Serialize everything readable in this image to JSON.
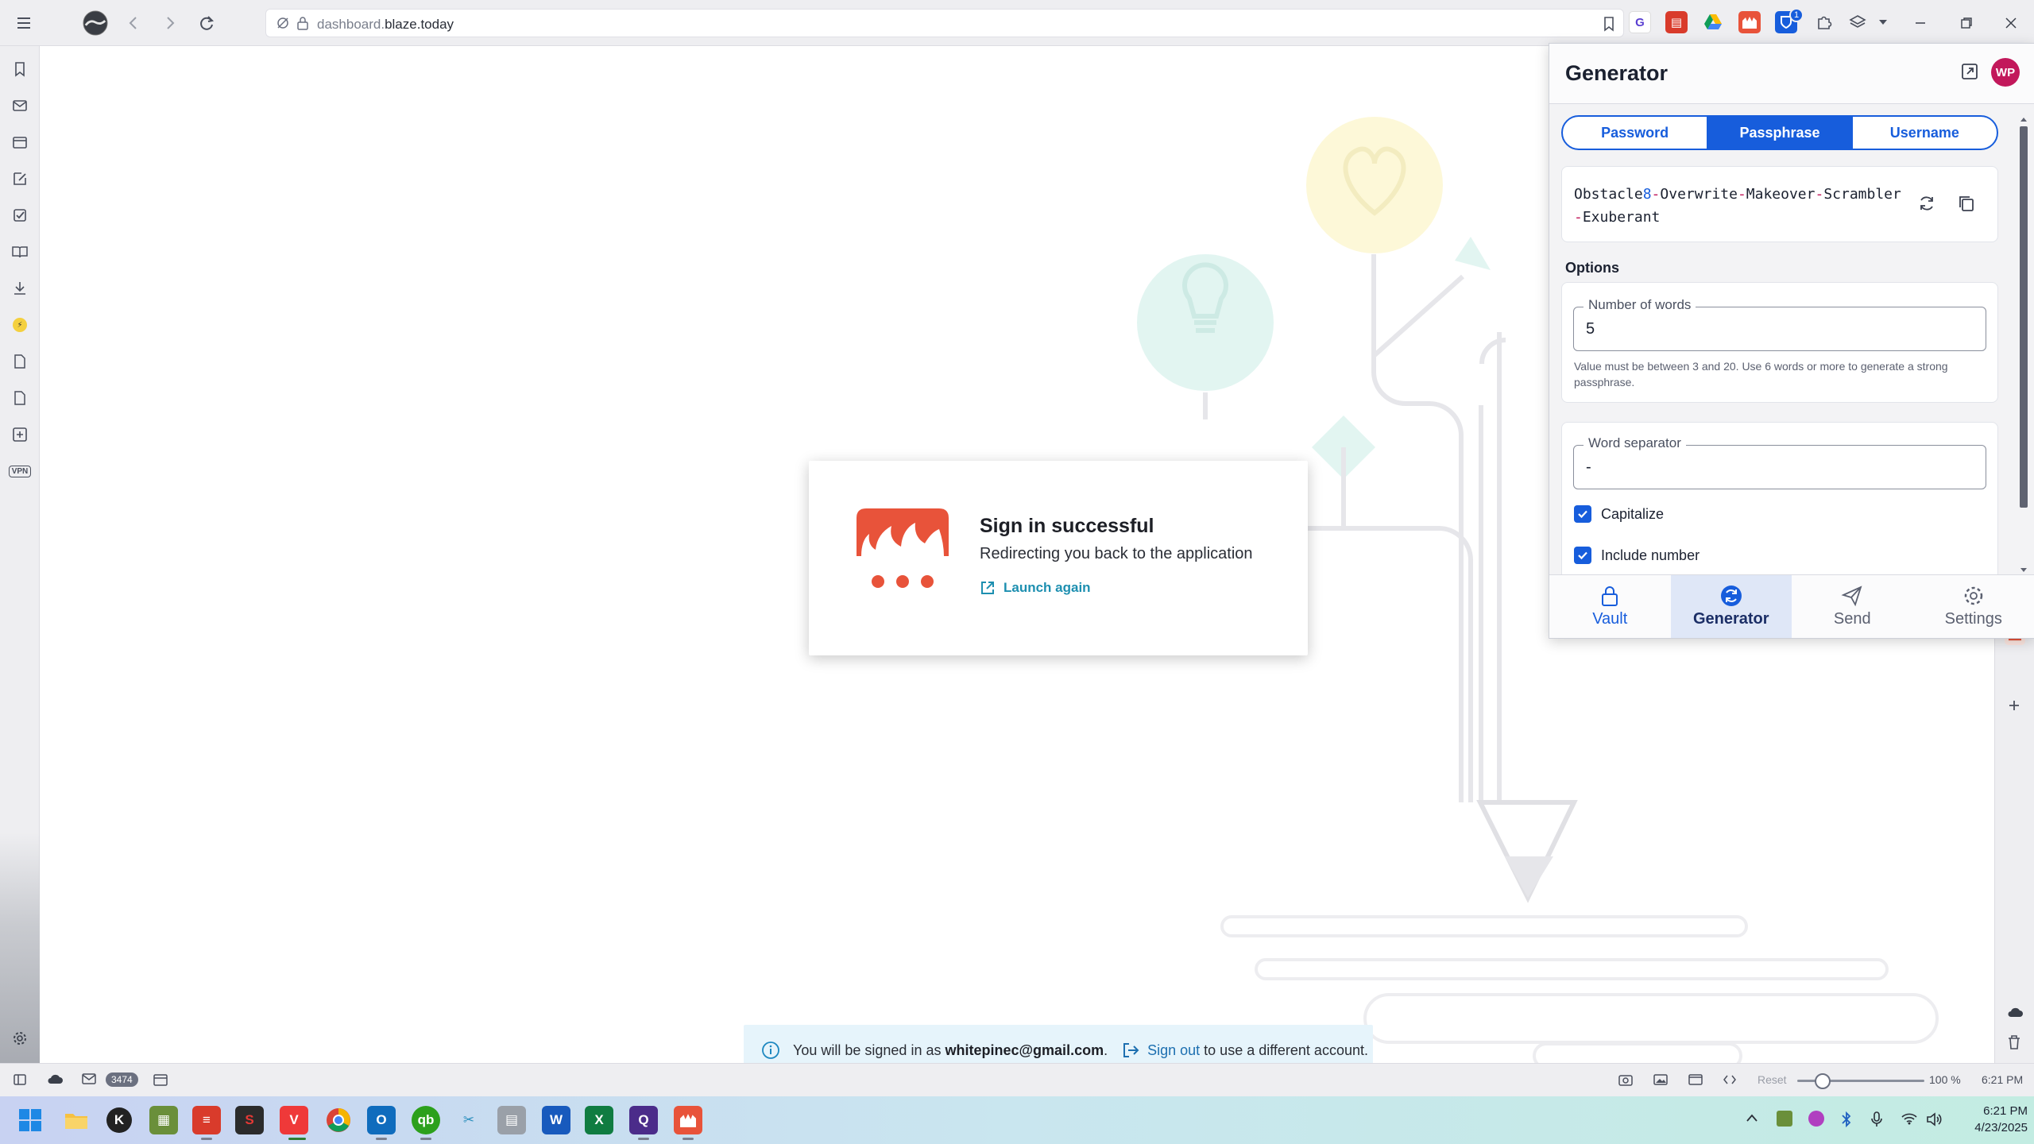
{
  "browser": {
    "url_prefix": "dashboard.",
    "url_domain": "blaze.today",
    "extension_badge": "1"
  },
  "signin_card": {
    "title": "Sign in successful",
    "subtitle": "Redirecting you back to the application",
    "launch_label": "Launch again"
  },
  "notice": {
    "prefix": "You will be signed in as",
    "email": "whitepinec@gmail.com",
    "period": ".",
    "signout_link": "Sign out",
    "suffix": "to use a different account."
  },
  "generator": {
    "title": "Generator",
    "avatar_initials": "WP",
    "tabs": [
      {
        "label": "Password",
        "active": false
      },
      {
        "label": "Passphrase",
        "active": true
      },
      {
        "label": "Username",
        "active": false
      }
    ],
    "passphrase_parts": {
      "w1": "Obstacle",
      "n": "8",
      "s1": "-",
      "w2": "Overwrite",
      "s2": "-",
      "w3": "Makeover",
      "s3": "-",
      "w4": "Scrambler",
      "s4": "-",
      "w5": "Exuberant"
    },
    "options_label": "Options",
    "num_words_label": "Number of words",
    "num_words_value": "5",
    "num_words_hint": "Value must be between 3 and 20. Use 6 words or more to generate a strong passphrase.",
    "separator_label": "Word separator",
    "separator_value": "-",
    "capitalize_label": "Capitalize",
    "capitalize_checked": true,
    "include_number_label": "Include number",
    "include_number_checked": true,
    "nav": [
      {
        "label": "Vault",
        "icon": "lock-icon"
      },
      {
        "label": "Generator",
        "icon": "generator-icon"
      },
      {
        "label": "Send",
        "icon": "send-icon"
      },
      {
        "label": "Settings",
        "icon": "gear-icon"
      }
    ],
    "brand_color": "#175ddc"
  },
  "statusbar": {
    "mail_count": "3474",
    "reset_label": "Reset",
    "zoom_level": "100 %",
    "zoom_fraction": 0.2,
    "time": "6:21 PM"
  },
  "taskbar": {
    "clock_time": "6:21 PM",
    "clock_date": "4/23/2025"
  }
}
